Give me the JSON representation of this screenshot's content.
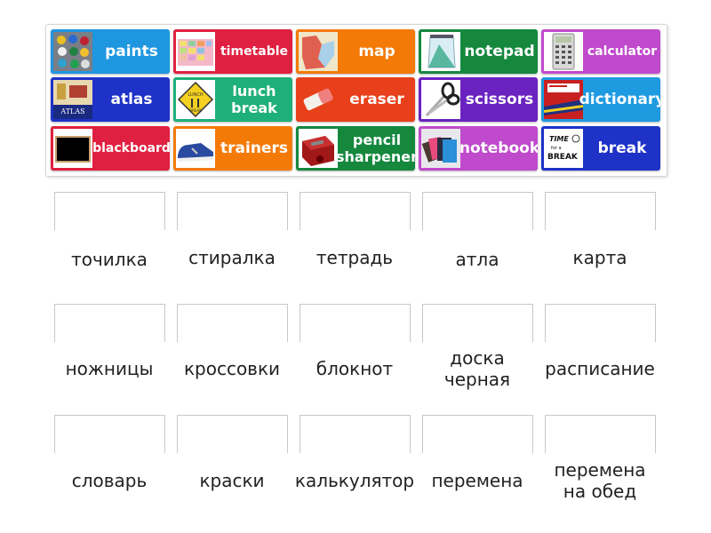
{
  "tiles": [
    {
      "label": "paints",
      "color": "#1E96E0",
      "image": "paint-cans-image"
    },
    {
      "label": "timetable",
      "color": "#E02040",
      "image": "timetable-image"
    },
    {
      "label": "map",
      "color": "#F47A08",
      "image": "map-image"
    },
    {
      "label": "notepad",
      "color": "#15883E",
      "image": "notepad-image"
    },
    {
      "label": "calculator",
      "color": "#C04ACC",
      "image": "calculator-image"
    },
    {
      "label": "atlas",
      "color": "#1E32C8",
      "image": "atlas-book-image"
    },
    {
      "label": "lunch break",
      "color": "#1EB07A",
      "image": "lunch-sign-image"
    },
    {
      "label": "eraser",
      "color": "#E8401A",
      "image": "eraser-image"
    },
    {
      "label": "scissors",
      "color": "#6A22C0",
      "image": "scissors-image"
    },
    {
      "label": "dictionary",
      "color": "#1E9AE0",
      "image": "dictionary-image"
    },
    {
      "label": "blackboard",
      "color": "#E02040",
      "image": "blackboard-image"
    },
    {
      "label": "trainers",
      "color": "#F47A08",
      "image": "trainers-shoe-image"
    },
    {
      "label": "pencil sharpener",
      "color": "#15883E",
      "image": "pencil-sharpener-image"
    },
    {
      "label": "notebook",
      "color": "#C04ACC",
      "image": "notebooks-image"
    },
    {
      "label": "break",
      "color": "#1E32C8",
      "image": "time-for-a-break-image"
    }
  ],
  "targets": [
    {
      "word": "точилка",
      "value": ""
    },
    {
      "word": "стиралка",
      "value": ""
    },
    {
      "word": "тетрадь",
      "value": ""
    },
    {
      "word": "атла",
      "value": ""
    },
    {
      "word": "карта",
      "value": ""
    },
    {
      "word": "ножницы",
      "value": ""
    },
    {
      "word": "кроссовки",
      "value": ""
    },
    {
      "word": "блокнот",
      "value": ""
    },
    {
      "word": "доска черная",
      "value": ""
    },
    {
      "word": "расписание",
      "value": ""
    },
    {
      "word": "словарь",
      "value": ""
    },
    {
      "word": "краски",
      "value": ""
    },
    {
      "word": "калькулятор",
      "value": ""
    },
    {
      "word": "перемена",
      "value": ""
    },
    {
      "word": "перемена на обед",
      "value": ""
    }
  ]
}
